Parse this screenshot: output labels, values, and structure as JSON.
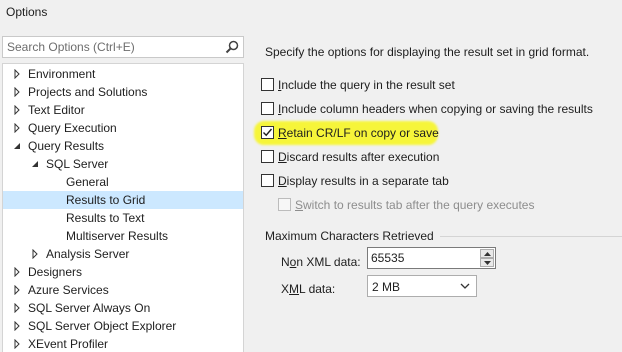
{
  "window": {
    "title": "Options"
  },
  "search": {
    "placeholder": "Search Options (Ctrl+E)"
  },
  "tree": {
    "items": [
      {
        "label": "Environment",
        "expanded": false
      },
      {
        "label": "Projects and Solutions",
        "expanded": false
      },
      {
        "label": "Text Editor",
        "expanded": false
      },
      {
        "label": "Query Execution",
        "expanded": false
      },
      {
        "label": "Query Results",
        "expanded": true
      },
      {
        "label": "SQL Server",
        "expanded": true
      },
      {
        "label": "General"
      },
      {
        "label": "Results to Grid",
        "selected": true
      },
      {
        "label": "Results to Text"
      },
      {
        "label": "Multiserver Results"
      },
      {
        "label": "Analysis Server",
        "expanded": false
      },
      {
        "label": "Designers",
        "expanded": false
      },
      {
        "label": "Azure Services",
        "expanded": false
      },
      {
        "label": "SQL Server Always On",
        "expanded": false
      },
      {
        "label": "SQL Server Object Explorer",
        "expanded": false
      },
      {
        "label": "XEvent Profiler",
        "expanded": false
      }
    ]
  },
  "main": {
    "description": "Specify the options for displaying the result set in grid format.",
    "options": [
      {
        "key": "I",
        "rest": "nclude the query in the result set",
        "checked": false
      },
      {
        "key": "I",
        "rest": "nclude column headers when copying or saving the results",
        "checked": false
      },
      {
        "key": "R",
        "rest": "etain CR/LF on copy or save",
        "checked": true
      },
      {
        "key": "D",
        "rest": "iscard results after execution",
        "checked": false
      },
      {
        "key": "D",
        "rest": "isplay results in a separate tab",
        "checked": false
      },
      {
        "key": "S",
        "rest": "witch to results tab after the query executes",
        "checked": false,
        "disabled": true
      }
    ],
    "max_chars": {
      "title": "Maximum Characters Retrieved",
      "non_xml_label_pre": "N",
      "non_xml_label_key": "o",
      "non_xml_label_post": "n XML data:",
      "non_xml_value": "65535",
      "xml_label_pre": "X",
      "xml_label_key": "M",
      "xml_label_post": "L data:",
      "xml_value": "2 MB"
    }
  },
  "colors": {
    "selection": "#cce8ff",
    "highlight": "#f6f53a"
  }
}
